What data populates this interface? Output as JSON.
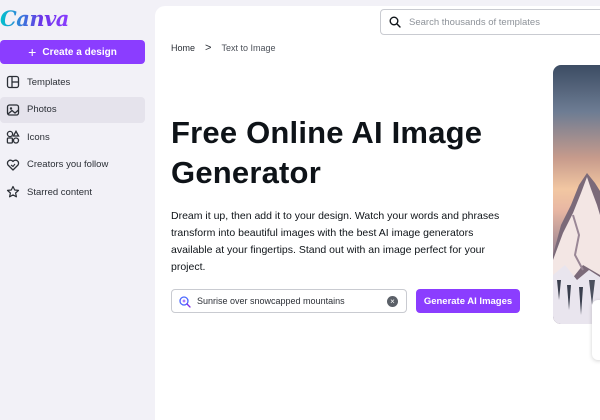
{
  "app": {
    "logo_text": "Canva"
  },
  "sidebar": {
    "create_label": "Create a design",
    "items": [
      {
        "label": "Templates",
        "icon": "templates-icon",
        "active": false
      },
      {
        "label": "Photos",
        "icon": "photos-icon",
        "active": true
      },
      {
        "label": "Icons",
        "icon": "icons-icon",
        "active": false
      },
      {
        "label": "Creators you follow",
        "icon": "heart-icon",
        "active": false
      },
      {
        "label": "Starred content",
        "icon": "star-icon",
        "active": false
      }
    ]
  },
  "header": {
    "search_placeholder": "Search thousands of templates"
  },
  "breadcrumb": {
    "home": "Home",
    "separator": ">",
    "current": "Text to Image"
  },
  "main": {
    "title": "Free Online AI Image Generator",
    "description": "Dream it up, then add it to your design. Watch your words and phrases transform into beautiful images with the best AI image generators available at your fingertips. Stand out with an image perfect for your project.",
    "prompt_value": "Sunrise over snowcapped mountains",
    "generate_label": "Generate AI Images"
  },
  "colors": {
    "brand": "#8b3dff",
    "sidebar_bg": "#f2f1f7",
    "text": "#0e1318"
  }
}
